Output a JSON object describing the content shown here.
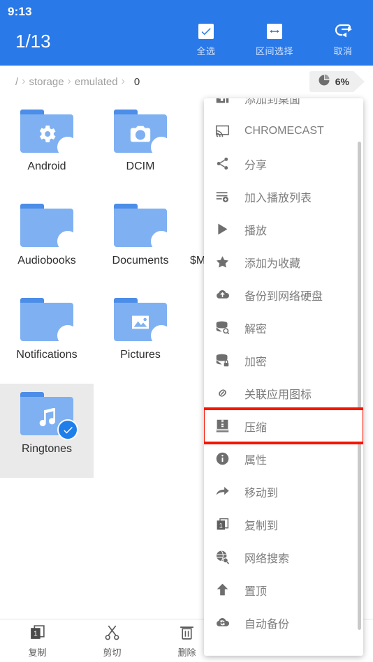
{
  "statusbar": {
    "time": "9:13"
  },
  "appbar": {
    "selection_count": "1/13",
    "actions": [
      {
        "icon": "check-icon",
        "label": "全选"
      },
      {
        "icon": "arrows-horizontal-icon",
        "label": "区间选择"
      },
      {
        "icon": "undo-arrow-icon",
        "label": "取消"
      }
    ]
  },
  "breadcrumb": {
    "root": "/",
    "separator": "›",
    "items": [
      "storage",
      "emulated"
    ],
    "current": "0"
  },
  "storage_badge": {
    "icon": "pie-chart-icon",
    "percent": "6%"
  },
  "grid": {
    "partial_item_label": "$M",
    "items": [
      {
        "name": "Android",
        "emblem": "gear-icon",
        "selected": false
      },
      {
        "name": "DCIM",
        "emblem": "camera-icon",
        "selected": false
      },
      {
        "name": "Audiobooks",
        "emblem": "none",
        "selected": false
      },
      {
        "name": "Documents",
        "emblem": "none",
        "selected": false
      },
      {
        "name": "Notifications",
        "emblem": "none",
        "selected": false
      },
      {
        "name": "Pictures",
        "emblem": "image-icon",
        "selected": false
      },
      {
        "name": "Ringtones",
        "emblem": "music-icon",
        "selected": true
      }
    ]
  },
  "context_menu": {
    "items": [
      {
        "icon": "add-to-desktop-icon",
        "label": "添加到桌面",
        "highlighted": false
      },
      {
        "icon": "chromecast-icon",
        "label": "CHROMECAST",
        "highlighted": false
      },
      {
        "icon": "share-icon",
        "label": "分享",
        "highlighted": false
      },
      {
        "icon": "add-to-playlist-icon",
        "label": "加入播放列表",
        "highlighted": false
      },
      {
        "icon": "play-icon",
        "label": "播放",
        "highlighted": false
      },
      {
        "icon": "star-icon",
        "label": "添加为收藏",
        "highlighted": false
      },
      {
        "icon": "cloud-upload-icon",
        "label": "备份到网络硬盘",
        "highlighted": false
      },
      {
        "icon": "decrypt-icon",
        "label": "解密",
        "highlighted": false
      },
      {
        "icon": "encrypt-icon",
        "label": "加密",
        "highlighted": false
      },
      {
        "icon": "link-icon",
        "label": "关联应用图标",
        "highlighted": false
      },
      {
        "icon": "compress-icon",
        "label": "压缩",
        "highlighted": true
      },
      {
        "icon": "info-icon",
        "label": "属性",
        "highlighted": false
      },
      {
        "icon": "move-to-icon",
        "label": "移动到",
        "highlighted": false
      },
      {
        "icon": "copy-to-icon",
        "label": "复制到",
        "highlighted": false
      },
      {
        "icon": "web-search-icon",
        "label": "网络搜索",
        "highlighted": false
      },
      {
        "icon": "pin-top-icon",
        "label": "置顶",
        "highlighted": false
      },
      {
        "icon": "auto-backup-icon",
        "label": "自动备份",
        "highlighted": false
      }
    ]
  },
  "bottombar": {
    "items": [
      {
        "icon": "copy-icon",
        "label": "复制"
      },
      {
        "icon": "cut-icon",
        "label": "剪切"
      },
      {
        "icon": "delete-icon",
        "label": "删除"
      }
    ]
  },
  "colors": {
    "accent_blue": "#2979E8",
    "folder_blue": "#7FB1F2",
    "highlight_red": "#F71400",
    "selected_bg": "#EAEAEA"
  }
}
